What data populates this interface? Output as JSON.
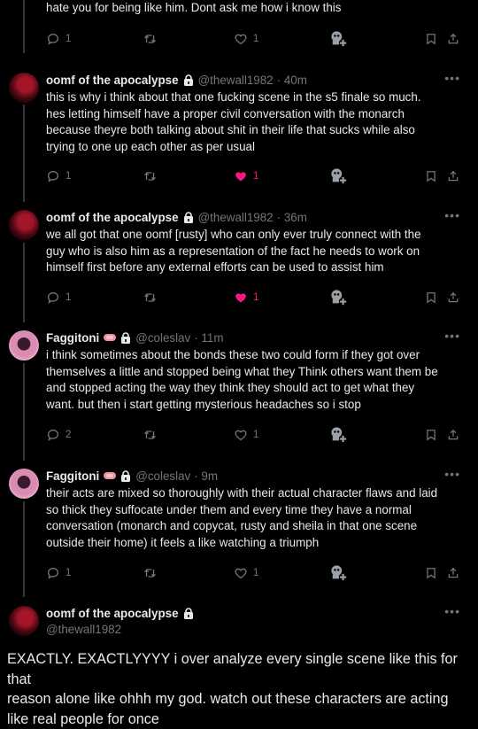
{
  "top_fragment": {
    "text": "hate you for being like him. Dont ask me how i know this",
    "replies": "1",
    "likes": "1"
  },
  "tweets": [
    {
      "name": "oomf of the apocalypse",
      "handle": "@thewall1982",
      "time": "· 40m",
      "lines": [
        "this is why i think about that one fucking scene in the s5 finale so much.",
        "hes letting himself have a proper civil conversation with the monarch",
        "because theyre both talking about shit in their life that sucks while also",
        "trying to one up each other as per usual"
      ],
      "replies": "1",
      "likes": "1",
      "liked": true
    },
    {
      "name": "oomf of the apocalypse",
      "handle": "@thewall1982",
      "time": "· 36m",
      "lines": [
        "we all got that one oomf [rusty] who can only ever truly connect with the",
        "guy who is also him as a representation of the fact he needs to work on",
        "himself first before any external efforts can be used to assist him"
      ],
      "replies": "1",
      "likes": "1",
      "liked": true
    },
    {
      "name": "Faggitoni",
      "handle": "@coleslav",
      "time": "· 11m",
      "lines": [
        "i think sometimes about the bonds these two could form if they got over",
        "themselves a little and stopped being what they Think others want them be",
        "and stopped acting the way they think they should act to get what they",
        "want. but then i start getting mysterious headaches so i stop"
      ],
      "replies": "2",
      "likes": "1",
      "liked": false
    },
    {
      "name": "Faggitoni",
      "handle": "@coleslav",
      "time": "· 9m",
      "lines": [
        "their acts are mixed so thoroughly with their actual character flaws and laid",
        "so thick they suffocate under them and every time they have a normal",
        "conversation (monarch and copycat, rusty and sheila in that one scene",
        "outside their home) it feels a like watching a triumph"
      ],
      "replies": "1",
      "likes": "1",
      "liked": false
    }
  ],
  "main_tweet": {
    "name": "oomf of the apocalypse",
    "handle": "@thewall1982",
    "lines": [
      "EXACTLY. EXACTLYYYY i over analyze every single scene like this for that",
      "reason alone like ohhh my god. watch out these characters are acting",
      "like real people for once"
    ]
  },
  "colors": {
    "background": "#000000",
    "text": "#e7e9ea",
    "muted": "#71767b",
    "like": "#f91880",
    "divider": "#333639"
  },
  "icons": [
    "reply-icon",
    "retweet-icon",
    "like-icon",
    "grok-icon",
    "bookmark-icon",
    "share-icon",
    "lock-icon",
    "more-icon"
  ]
}
